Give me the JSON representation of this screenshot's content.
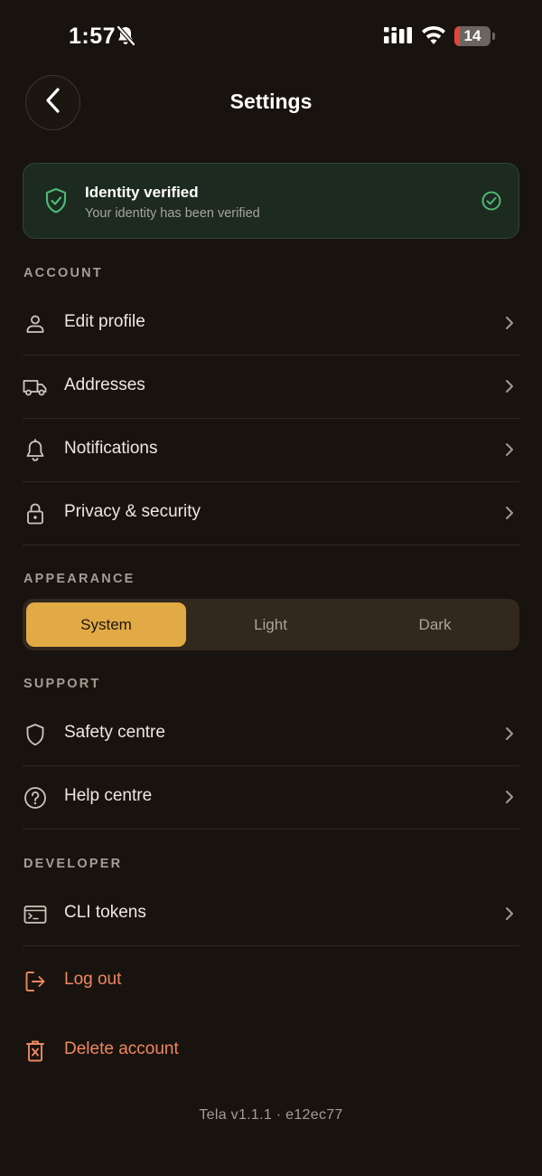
{
  "status_bar": {
    "time": "1:57",
    "battery_level": "14",
    "battery_fraction": 0.14,
    "battery_color": "#e5443b"
  },
  "header": {
    "title": "Settings",
    "back_icon": "chevron-left-icon"
  },
  "verification": {
    "title": "Identity verified",
    "subtitle": "Your identity has been verified",
    "color": "#2f4634"
  },
  "sections": {
    "account": {
      "label": "ACCOUNT",
      "items": [
        {
          "label": "Edit profile",
          "icon": "user-icon"
        },
        {
          "label": "Addresses",
          "icon": "truck-icon"
        },
        {
          "label": "Notifications",
          "icon": "bell-icon"
        },
        {
          "label": "Privacy & security",
          "icon": "lock-icon"
        }
      ]
    },
    "appearance": {
      "label": "APPEARANCE",
      "options": [
        "System",
        "Light",
        "Dark"
      ],
      "selected": "System"
    },
    "support": {
      "label": "SUPPORT",
      "items": [
        {
          "label": "Safety centre",
          "icon": "shield-icon"
        },
        {
          "label": "Help centre",
          "icon": "help-circle-icon"
        }
      ]
    },
    "developer": {
      "label": "DEVELOPER",
      "items": [
        {
          "label": "CLI tokens",
          "icon": "terminal-icon"
        }
      ]
    }
  },
  "actions": {
    "logout": {
      "label": "Log out",
      "icon": "logout-icon"
    },
    "delete": {
      "label": "Delete account",
      "icon": "trash-icon"
    },
    "danger_color": "#ee8762"
  },
  "accent_color": "#e2aa45",
  "footer": {
    "version": "Tela v1.1.1 · e12ec77"
  }
}
